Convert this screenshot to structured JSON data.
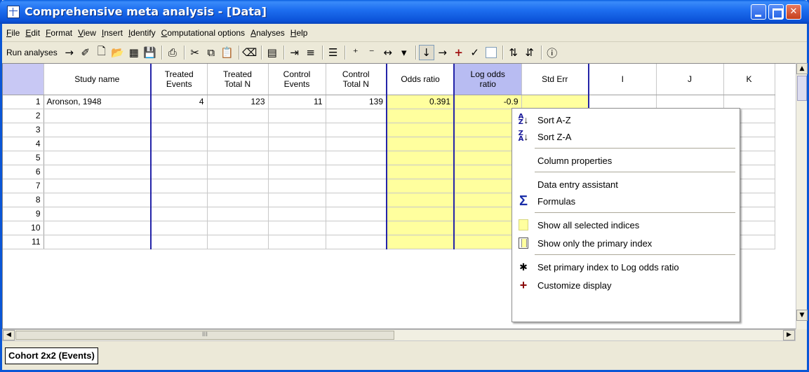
{
  "window": {
    "title": "Comprehensive meta analysis - [Data]",
    "min_glyph": "_",
    "max_glyph": "",
    "close_glyph": "✕"
  },
  "menu": [
    "File",
    "Edit",
    "Format",
    "View",
    "Insert",
    "Identify",
    "Computational options",
    "Analyses",
    "Help"
  ],
  "toolbar": {
    "run_label": "Run analyses"
  },
  "grid": {
    "columns": [
      "Study name",
      "Treated\nEvents",
      "Treated\nTotal N",
      "Control\nEvents",
      "Control\nTotal N",
      "Odds ratio",
      "Log odds\nratio",
      "Std Err",
      "I",
      "J",
      "K"
    ],
    "rows": [
      [
        "Aronson, 1948",
        "4",
        "123",
        "11",
        "139",
        "0.391",
        "-0.9"
      ],
      [],
      [],
      [],
      [],
      [],
      [],
      [],
      [],
      [],
      []
    ],
    "row_numbers": [
      "1",
      "2",
      "3",
      "4",
      "5",
      "6",
      "7",
      "8",
      "9",
      "10",
      "11"
    ]
  },
  "hscroll_grip": "III",
  "tab": {
    "label": "Cohort 2x2 (Events)"
  },
  "context_menu": {
    "items": [
      {
        "label": "Sort A-Z",
        "icon": "sort-az-icon"
      },
      {
        "label": "Sort Z-A",
        "icon": "sort-za-icon"
      },
      {
        "label": "Column properties",
        "icon": ""
      },
      {
        "label": "Data entry assistant",
        "icon": ""
      },
      {
        "label": "Formulas",
        "icon": "sigma-icon"
      },
      {
        "label": "Show all selected indices",
        "icon": "all-indices-icon"
      },
      {
        "label": "Show only the primary index",
        "icon": "primary-index-icon"
      },
      {
        "label": "Set primary index to Log odds ratio",
        "icon": "set-primary-icon"
      },
      {
        "label": "Customize display",
        "icon": "plus-icon"
      }
    ]
  },
  "colors": {
    "titlebar": "#0b52d8",
    "highlight_yellow": "#ffff9e",
    "selected_header": "#b8bcf2",
    "column_divider": "#2424a8"
  }
}
